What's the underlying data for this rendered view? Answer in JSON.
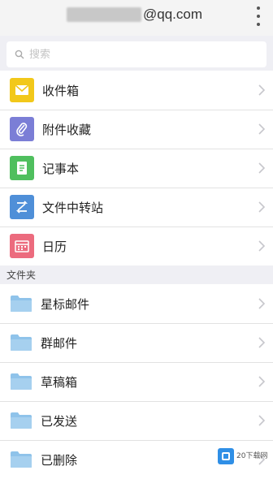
{
  "header": {
    "account_domain": "@qq.com",
    "menu_icon": "more-vertical-icon"
  },
  "search": {
    "placeholder": "搜索",
    "icon": "search-icon"
  },
  "main_items": [
    {
      "label": "收件箱",
      "icon": "inbox-icon",
      "color": "#f2c81a"
    },
    {
      "label": "附件收藏",
      "icon": "paperclip-icon",
      "color": "#7b7ed6"
    },
    {
      "label": "记事本",
      "icon": "notepad-icon",
      "color": "#4fbf5e"
    },
    {
      "label": "文件中转站",
      "icon": "file-transfer-icon",
      "color": "#4f8fd8"
    },
    {
      "label": "日历",
      "icon": "calendar-icon",
      "color": "#ec6b7e"
    }
  ],
  "folders_section": {
    "title": "文件夹",
    "items": [
      {
        "label": "星标邮件",
        "icon": "folder-icon"
      },
      {
        "label": "群邮件",
        "icon": "folder-icon"
      },
      {
        "label": "草稿箱",
        "icon": "folder-icon"
      },
      {
        "label": "已发送",
        "icon": "folder-icon"
      },
      {
        "label": "已删除",
        "icon": "folder-icon"
      }
    ]
  },
  "watermark": {
    "text": "20下载网"
  },
  "colors": {
    "folder": "#8fc3ea",
    "chevron": "#c7c7cc",
    "background": "#efeff4"
  }
}
